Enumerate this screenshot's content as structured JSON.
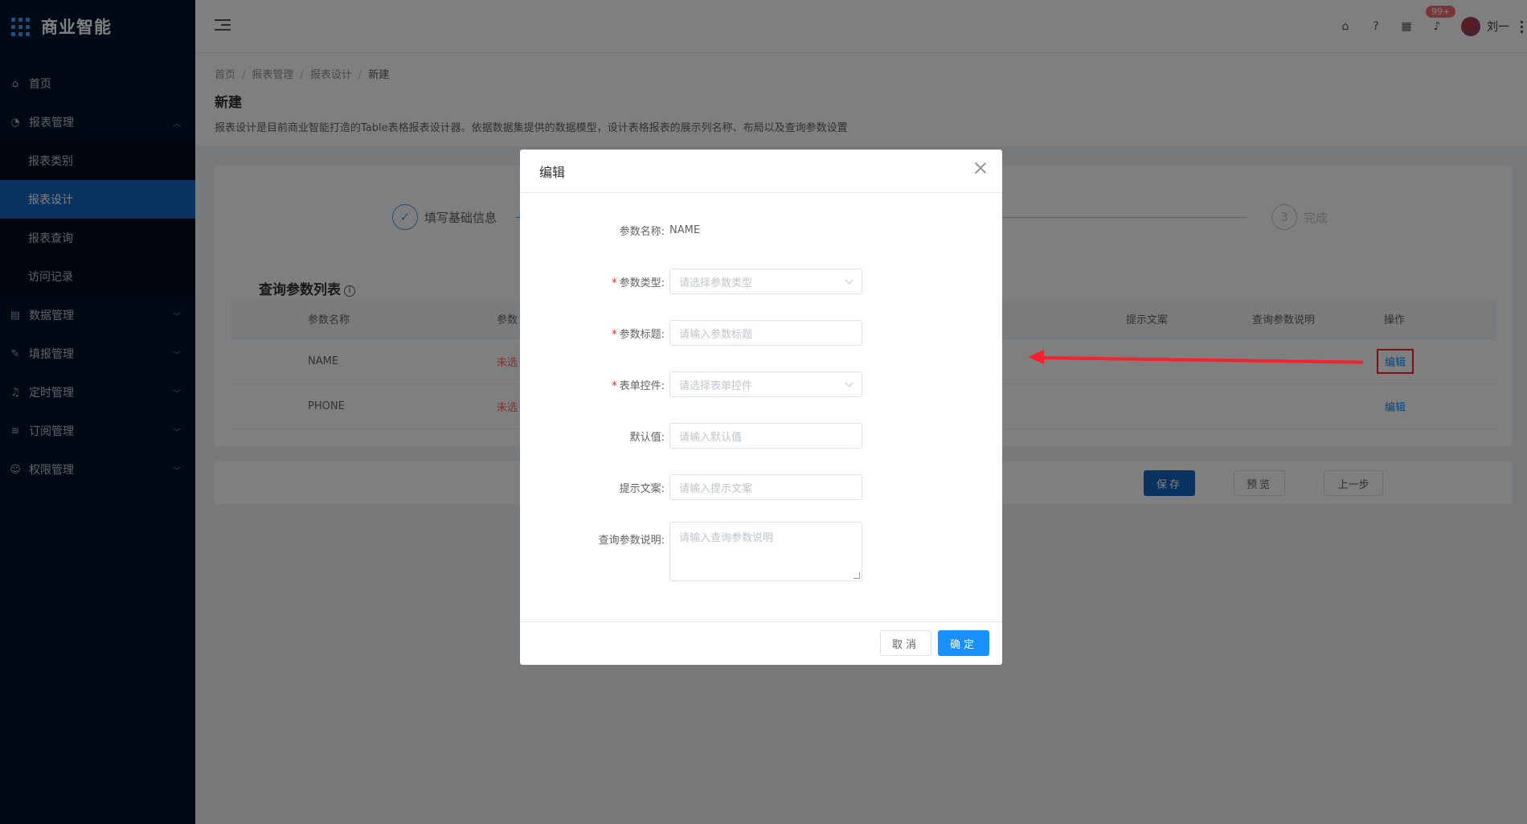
{
  "app": {
    "title": "商业智能"
  },
  "sidebar": {
    "items": [
      {
        "label": "首页",
        "icon": "bank-icon"
      },
      {
        "label": "报表管理",
        "icon": "dashboard-icon",
        "expanded": true,
        "children": [
          {
            "label": "报表类别"
          },
          {
            "label": "报表设计",
            "active": true
          },
          {
            "label": "报表查询"
          },
          {
            "label": "访问记录"
          }
        ]
      },
      {
        "label": "数据管理",
        "icon": "database-icon"
      },
      {
        "label": "填报管理",
        "icon": "edit-icon"
      },
      {
        "label": "定时管理",
        "icon": "bell-icon"
      },
      {
        "label": "订阅管理",
        "icon": "wifi-icon"
      },
      {
        "label": "权限管理",
        "icon": "user-icon"
      }
    ]
  },
  "header": {
    "badge": "99+",
    "username": "刘一"
  },
  "breadcrumb": [
    "首页",
    "报表管理",
    "报表设计",
    "新建"
  ],
  "page": {
    "title": "新建",
    "description": "报表设计是目前商业智能打造的Table表格报表设计器。依据数据集提供的数据模型，设计表格报表的展示列名称、布局以及查询参数设置"
  },
  "steps": [
    {
      "label": "填写基础信息",
      "status": "done"
    },
    {
      "label": "完成",
      "number": "3",
      "status": "wait"
    }
  ],
  "param_section": {
    "title": "查询参数列表",
    "columns": [
      "参数名称",
      "参数",
      "提示文案",
      "查询参数说明",
      "操作"
    ],
    "rows": [
      {
        "name": "NAME",
        "type_status": "未选",
        "action": "编辑"
      },
      {
        "name": "PHONE",
        "type_status": "未选",
        "action": "编辑"
      }
    ]
  },
  "actions": {
    "save": "保存",
    "preview": "预览",
    "prev": "上一步"
  },
  "dialog": {
    "title": "编辑",
    "fields": {
      "param_name_label": "参数名称:",
      "param_name_value": "NAME",
      "param_type_label": "参数类型:",
      "param_type_placeholder": "请选择参数类型",
      "param_title_label": "参数标题:",
      "param_title_placeholder": "请输入参数标题",
      "form_control_label": "表单控件:",
      "form_control_placeholder": "请选择表单控件",
      "default_label": "默认值:",
      "default_placeholder": "请输入默认值",
      "hint_label": "提示文案:",
      "hint_placeholder": "请输入提示文案",
      "desc_label": "查询参数说明:",
      "desc_placeholder": "请输入查询参数说明"
    },
    "cancel": "取消",
    "ok": "确定"
  },
  "colors": {
    "primary": "#1890ff",
    "sidebar_bg": "#001529",
    "highlight": "#f5222d"
  }
}
